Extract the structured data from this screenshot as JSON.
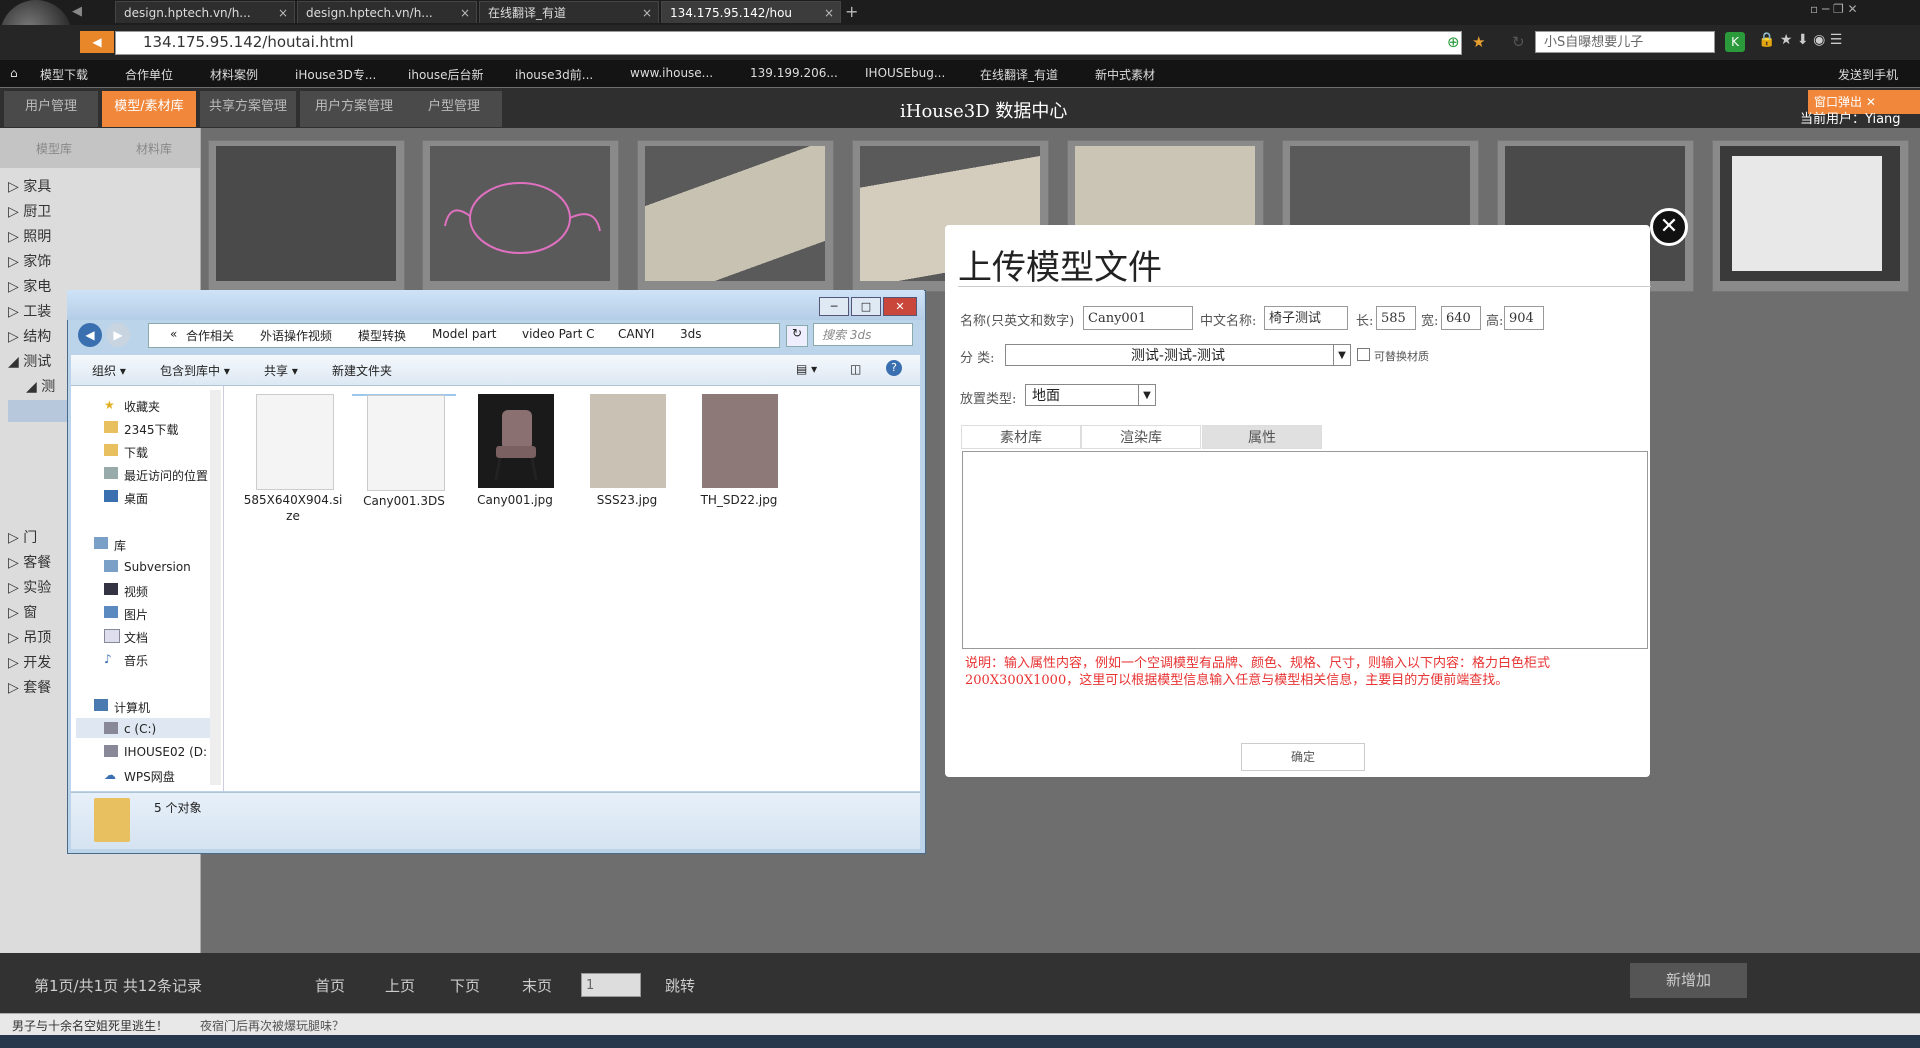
{
  "browser": {
    "tabs": [
      {
        "title": "design.hptech.vn/h..."
      },
      {
        "title": "design.hptech.vn/h..."
      },
      {
        "title": "在线翻译_有道"
      },
      {
        "title": "134.175.95.142/hou"
      }
    ],
    "url": "134.175.95.142/houtai.html",
    "search_placeholder": "小S自曝想要儿子",
    "bookmarks": [
      "模型下载",
      "合作单位",
      "材料案例",
      "iHouse3D专...",
      "ihouse后台新",
      "ihouse3d前...",
      "www.ihouse...",
      "139.199.206...",
      "IHOUSEbug...",
      "在线翻译_有道",
      "新中式素材"
    ],
    "send_to_phone": "发送到手机"
  },
  "app": {
    "nav": [
      "用户管理",
      "模型/素材库",
      "共享方案管理",
      "用户方案管理",
      "户型管理"
    ],
    "active_nav": 1,
    "title": "iHouse3D 数据中心",
    "popup_button": "窗口弹出",
    "current_user": "当前用户：Yiang",
    "left_tabs": [
      "模型库",
      "材料库"
    ],
    "tree": [
      "家具",
      "厨卫",
      "照明",
      "家饰",
      "家电",
      "工装",
      "结构",
      "测试",
      "测",
      "门",
      "客餐",
      "实验",
      "窗",
      "吊顶",
      "开发",
      "套餐"
    ],
    "pager": {
      "summary": "第1页/共1页 共12条记录",
      "first": "首页",
      "prev": "上页",
      "next": "下页",
      "last": "末页",
      "page_value": "1",
      "jump": "跳转"
    },
    "add_button": "新增加"
  },
  "status_bar": {
    "items": [
      "男子与十余名空姐死里逃生！",
      "夜宿门后再次被爆玩腿味？"
    ]
  },
  "upload_dialog": {
    "title": "上传模型文件",
    "name_label": "名称(只英文和数字)",
    "name_value": "Cany001",
    "cn_name_label": "中文名称:",
    "cn_name_value": "椅子测试",
    "length_label": "长:",
    "length_value": "585",
    "width_label": "宽:",
    "width_value": "640",
    "height_label": "高:",
    "height_value": "904",
    "category_label": "分  类:",
    "category_value": "测试-测试-测试",
    "replaceable_label": "可替换材质",
    "placement_label": "放置类型:",
    "placement_value": "地面",
    "tabs": [
      "素材库",
      "渲染库",
      "属性"
    ],
    "active_tab": 2,
    "note": "说明：输入属性内容，例如一个空调模型有品牌、颜色、规格、尺寸，则输入以下内容：格力白色柜式200X300X1000，这里可以根据模型信息输入任意与模型相关信息，主要目的方便前端查找。",
    "ok_button": "确定"
  },
  "explorer": {
    "breadcrumb": [
      "«",
      "合作相关",
      "外语操作视频",
      "模型转换",
      "Model part",
      "video Part C",
      "CANYI",
      "3ds"
    ],
    "search_placeholder": "搜索 3ds",
    "toolbar": [
      "组织 ▾",
      "包含到库中 ▾",
      "共享 ▾",
      "新建文件夹"
    ],
    "nav": [
      {
        "label": "收藏夹",
        "icon": "star-icon"
      },
      {
        "label": "2345下载",
        "icon": "folder-icon"
      },
      {
        "label": "下载",
        "icon": "folder-icon"
      },
      {
        "label": "最近访问的位置",
        "icon": "recent-icon"
      },
      {
        "label": "桌面",
        "icon": "desktop-icon"
      },
      {
        "label": "库",
        "icon": "library-icon"
      },
      {
        "label": "Subversion",
        "icon": "library-icon"
      },
      {
        "label": "视频",
        "icon": "video-icon"
      },
      {
        "label": "图片",
        "icon": "picture-icon"
      },
      {
        "label": "文档",
        "icon": "document-icon"
      },
      {
        "label": "音乐",
        "icon": "music-icon"
      },
      {
        "label": "计算机",
        "icon": "computer-icon"
      },
      {
        "label": "c (C:)",
        "icon": "drive-icon"
      },
      {
        "label": "IHOUSE02 (D:",
        "icon": "drive-icon"
      },
      {
        "label": "WPS网盘",
        "icon": "cloud-icon"
      }
    ],
    "files": [
      {
        "name": "585X640X904.size",
        "type": "blank"
      },
      {
        "name": "Cany001.3DS",
        "type": "blank"
      },
      {
        "name": "Cany001.jpg",
        "type": "chair"
      },
      {
        "name": "SSS23.jpg",
        "type": "fabric"
      },
      {
        "name": "TH_SD22.jpg",
        "type": "mauve"
      }
    ],
    "status": "5 个对象"
  },
  "colors": {
    "accent": "#f0873a",
    "note_red": "#e83333"
  }
}
